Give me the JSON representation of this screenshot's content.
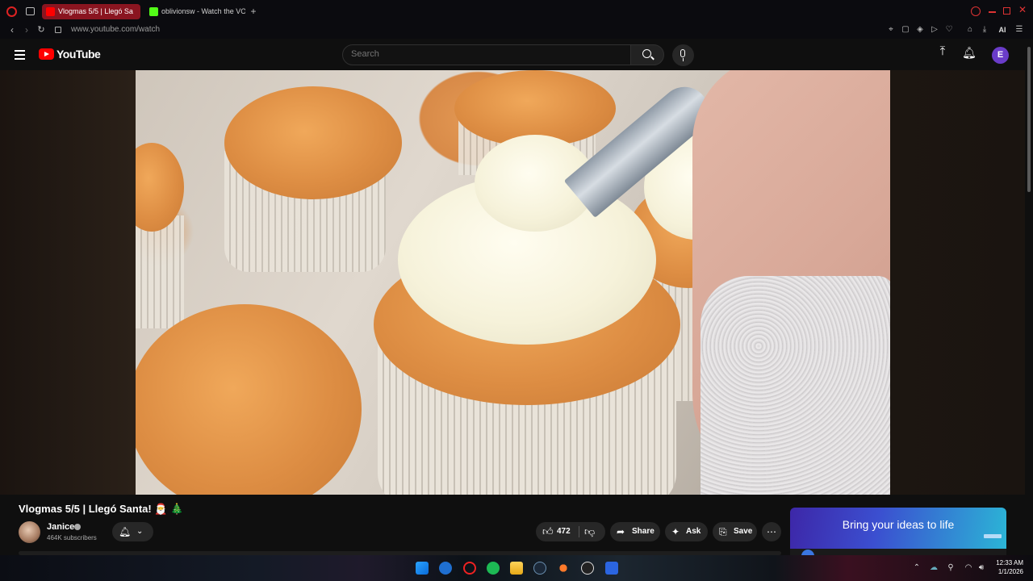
{
  "browser": {
    "tabs": [
      {
        "label": "Vlogmas 5/5 | Llegó Sa",
        "active": true
      },
      {
        "label": "oblivionsw - Watch the VO",
        "active": false
      }
    ],
    "url": "www.youtube.com/watch",
    "toolbar_text": "AI"
  },
  "youtube": {
    "logo_text": "YouTube",
    "search": {
      "placeholder": "Search",
      "value": ""
    },
    "avatar_letter": "E"
  },
  "video": {
    "title": "Vlogmas 5/5 | Llegó Santa! 🎅 🎄",
    "channel": {
      "name": "Janice",
      "subscribers": "464K subscribers"
    },
    "actions": {
      "like_count": "472",
      "share_label": "Share",
      "ask_label": "Ask",
      "save_label": "Save"
    }
  },
  "ad": {
    "text": "Bring your ideas to life"
  },
  "taskbar": {
    "time": "12:33 AM",
    "date": "1/1/2026"
  },
  "colors": {
    "accent_red": "#ff0000",
    "opera_active_tab": "#8a1520",
    "avatar_purple": "#6a3cc9"
  }
}
